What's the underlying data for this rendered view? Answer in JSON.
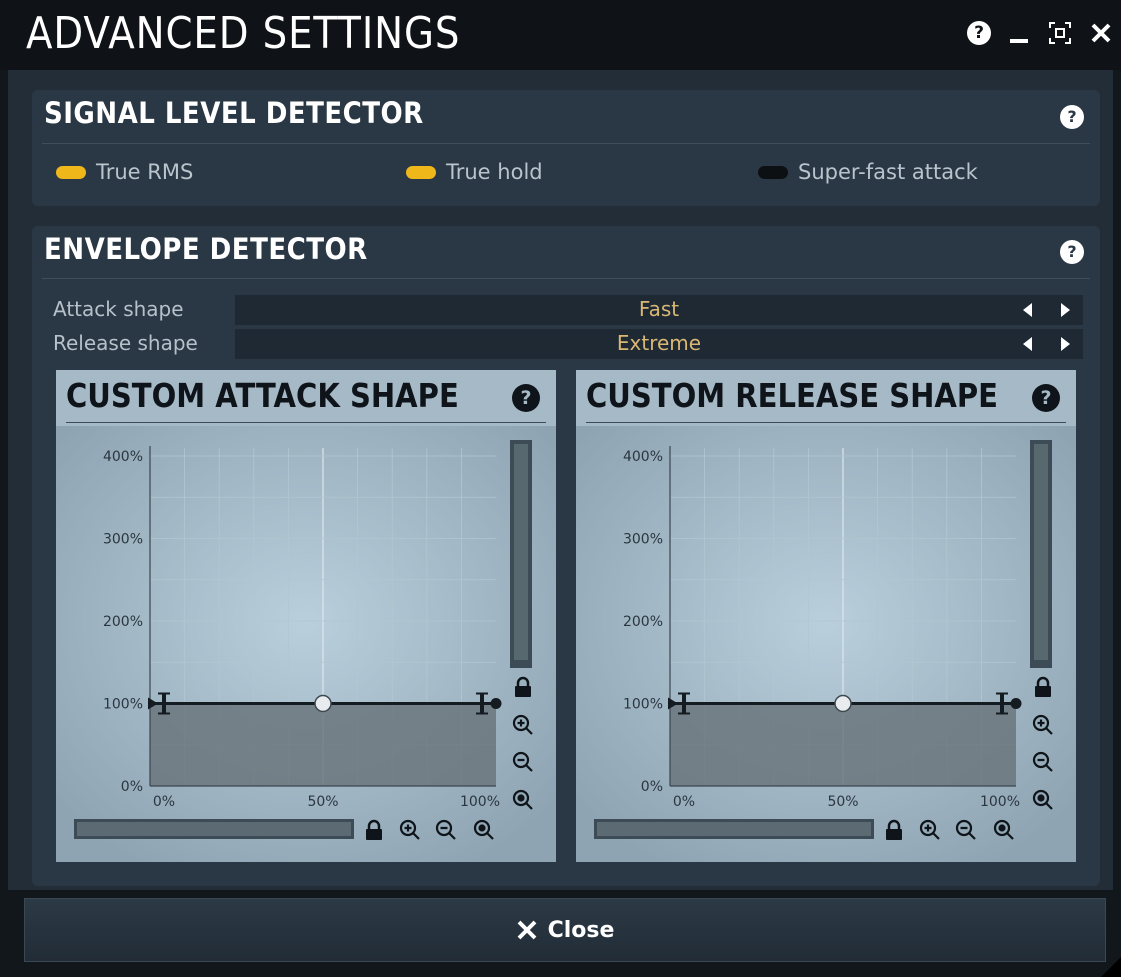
{
  "window": {
    "title": "ADVANCED SETTINGS",
    "help_label": "?"
  },
  "signal_level_detector": {
    "title": "SIGNAL LEVEL DETECTOR",
    "help_label": "?",
    "switches": [
      {
        "label": "True RMS",
        "on": true
      },
      {
        "label": "True hold",
        "on": true
      },
      {
        "label": "Super-fast attack",
        "on": false
      }
    ]
  },
  "envelope_detector": {
    "title": "ENVELOPE DETECTOR",
    "help_label": "?",
    "params": [
      {
        "label": "Attack shape",
        "value": "Fast"
      },
      {
        "label": "Release shape",
        "value": "Extreme"
      }
    ]
  },
  "custom_attack_shape": {
    "title": "CUSTOM ATTACK SHAPE",
    "help_label": "?",
    "y_ticks": [
      "400%",
      "300%",
      "200%",
      "100%",
      "0%"
    ],
    "x_ticks": [
      "0%",
      "50%",
      "100%"
    ],
    "curve_level": 100
  },
  "custom_release_shape": {
    "title": "CUSTOM RELEASE SHAPE",
    "help_label": "?",
    "y_ticks": [
      "400%",
      "300%",
      "200%",
      "100%",
      "0%"
    ],
    "x_ticks": [
      "0%",
      "50%",
      "100%"
    ],
    "curve_level": 100
  },
  "footer": {
    "close_label": "Close"
  },
  "colors": {
    "switch_on": "#f0b71a",
    "switch_off": "#0c1013",
    "param_value": "#d9b775"
  },
  "icons": [
    "help-icon",
    "minimize-icon",
    "fullscreen-icon",
    "close-icon",
    "lock-icon",
    "zoom-in-icon",
    "zoom-out-icon",
    "zoom-reset-icon"
  ]
}
